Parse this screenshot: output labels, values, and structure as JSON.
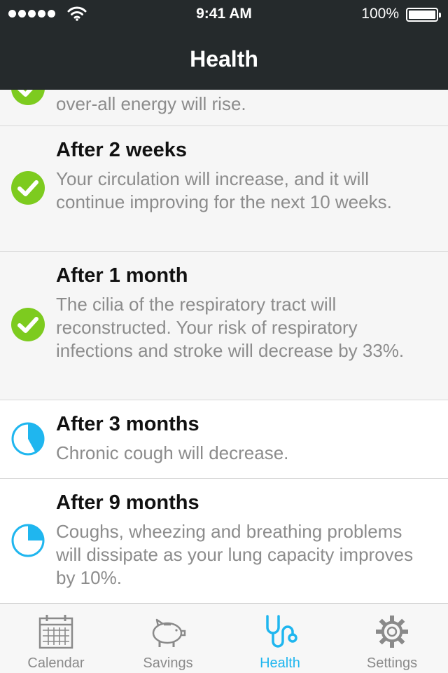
{
  "status_bar": {
    "time": "9:41 AM",
    "battery_percent": "100%",
    "signal_bars": 5,
    "icons": [
      "signal-icon",
      "wifi-icon",
      "battery-icon"
    ]
  },
  "header": {
    "title": "Health"
  },
  "colors": {
    "bar_background": "#252a2c",
    "completed_green": "#7dcb1f",
    "progress_blue": "#1fb6ef",
    "muted_text": "#8c8c8c",
    "completed_row_bg": "#f6f6f6"
  },
  "milestones": [
    {
      "title": "",
      "description": "over-all energy will rise.",
      "status": "completed",
      "icon": "checkmark-circle-icon"
    },
    {
      "title": "After 2 weeks",
      "description": "Your circulation will increase, and it will continue improving for the next 10 weeks.",
      "status": "completed",
      "icon": "checkmark-circle-icon"
    },
    {
      "title": "After 1 month",
      "description": "The cilia of the respiratory tract will reconstructed. Your risk of respiratory infections and stroke will decrease by 33%.",
      "status": "completed",
      "icon": "checkmark-circle-icon"
    },
    {
      "title": "After 3 months",
      "description": "Chronic cough will decrease.",
      "status": "in-progress",
      "progress_fraction": 0.42,
      "icon": "progress-pie-icon"
    },
    {
      "title": "After 9 months",
      "description": "Coughs, wheezing and breathing problems will dissipate as your lung capacity improves by 10%.",
      "status": "in-progress",
      "progress_fraction": 0.25,
      "icon": "progress-pie-icon"
    }
  ],
  "tab_bar": {
    "active": "Health",
    "tabs": [
      {
        "label": "Calendar",
        "icon": "calendar-icon"
      },
      {
        "label": "Savings",
        "icon": "piggy-bank-icon"
      },
      {
        "label": "Health",
        "icon": "stethoscope-icon"
      },
      {
        "label": "Settings",
        "icon": "gear-icon"
      }
    ]
  }
}
